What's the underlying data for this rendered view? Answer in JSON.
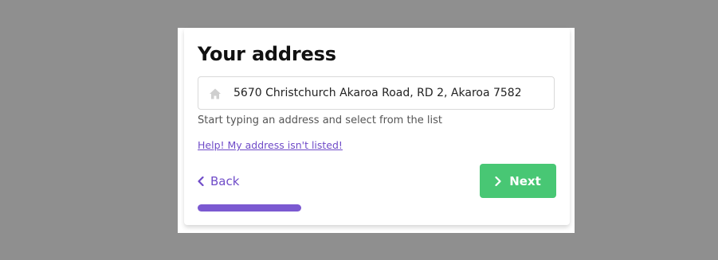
{
  "form": {
    "title": "Your address",
    "address_value": "5670 Christchurch Akaroa Road, RD 2, Akaroa 7582",
    "hint": "Start typing an address and select from the list",
    "help_link": "Help! My address isn't listed!",
    "back_label": "Back",
    "next_label": "Next",
    "progress_fraction": 0.29
  },
  "icons": {
    "address_field": "home-icon",
    "back": "chevron-left-icon",
    "next": "chevron-right-icon"
  },
  "colors": {
    "backdrop": "#8f8f8f",
    "accent": "#6f4bc8",
    "progress": "#7b59d1",
    "primary_button": "#48c774"
  }
}
